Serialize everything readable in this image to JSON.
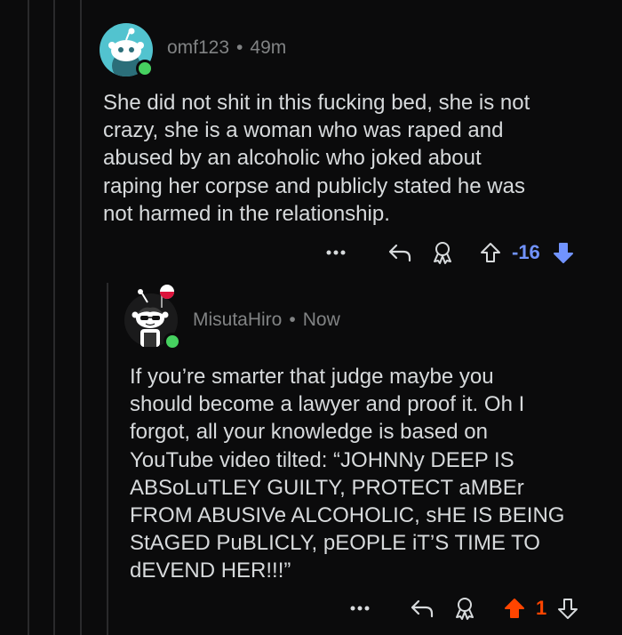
{
  "comments": [
    {
      "username": "omf123",
      "separator": "•",
      "time": "49m",
      "body": "She did not shit in this fucking bed, she is not\ncrazy, she is a woman who was raped and\nabused by an alcoholic who joked about\nraping her corpse and publicly stated he was\nnot harmed in the relationship.",
      "score": "-16",
      "vote_state": "downvoted",
      "score_color": "#7193ff"
    },
    {
      "username": "MisutaHiro",
      "separator": "•",
      "time": "Now",
      "body": "If you’re smarter that judge maybe you\nshould become a lawyer and proof it. Oh I\nforgot, all your knowledge is based on\nYouTube video tilted: “JOHNNy DEEP IS\nABSoLuTLEY GUILTY, PROTECT aMBEr\nFROM ABUSIVe ALCOHOLIC, sHE IS BEING\nStAGED PuBLICLY, pEOPLE iT’S TIME TO\ndEVEND HER!!!”",
      "score": "1",
      "vote_state": "upvoted",
      "score_color": "#ff4500"
    }
  ],
  "icons": {
    "more": "more-options-icon",
    "reply": "reply-icon",
    "award": "award-icon",
    "upvote": "upvote-arrow-icon",
    "downvote": "downvote-arrow-icon"
  },
  "colors": {
    "background": "#0b0b0c",
    "text": "#d7dadc",
    "meta": "#818384",
    "online": "#46d160",
    "upvote_active": "#ff4500",
    "downvote_active": "#7193ff"
  }
}
